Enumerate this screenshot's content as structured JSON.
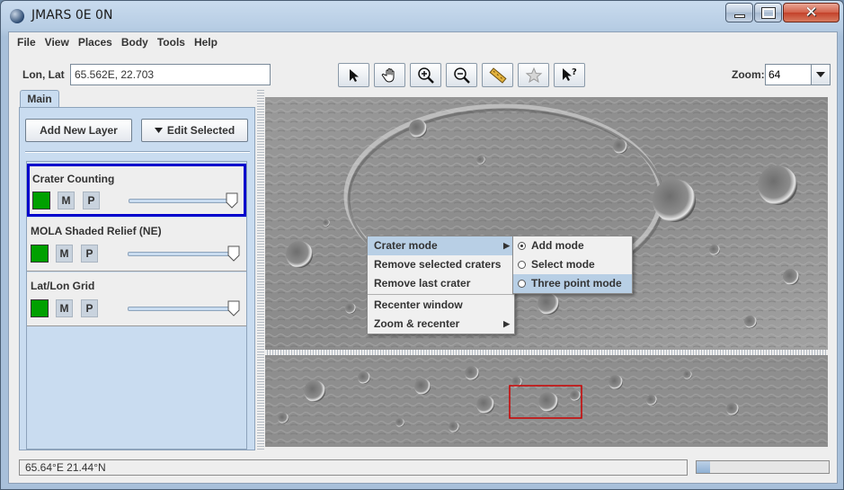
{
  "window": {
    "title": "JMARS 0E 0N"
  },
  "menubar": {
    "items": [
      "File",
      "View",
      "Places",
      "Body",
      "Tools",
      "Help"
    ]
  },
  "toolbar": {
    "lonlat_label": "Lon, Lat",
    "lonlat_value": "65.562E, 22.703",
    "tools": [
      "select-arrow-icon",
      "pan-hand-icon",
      "zoom-in-icon",
      "zoom-out-icon",
      "ruler-icon",
      "investigate-star-icon",
      "pointer-help-icon"
    ],
    "zoom_label": "Zoom:",
    "zoom_value": "64"
  },
  "leftpanel": {
    "tab": "Main",
    "add_layer_button": "Add New Layer",
    "edit_selected_button": "Edit Selected",
    "layers": [
      {
        "name": "Crater Counting",
        "m": "M",
        "p": "P",
        "color": "#00a000"
      },
      {
        "name": "MOLA Shaded Relief (NE)",
        "m": "M",
        "p": "P",
        "color": "#00a000"
      },
      {
        "name": "Lat/Lon Grid",
        "m": "M",
        "p": "P",
        "color": "#00a000"
      }
    ]
  },
  "context_menu": {
    "items": [
      "Crater mode",
      "Remove selected craters",
      "Remove last crater",
      "Recenter window",
      "Zoom & recenter"
    ],
    "submenu": [
      "Add mode",
      "Select mode",
      "Three point mode"
    ]
  },
  "statusbar": {
    "coords": "65.64°E   21.44°N"
  },
  "progress": {
    "fraction": 0.1
  },
  "colors": {
    "selection_border": "#0000cc",
    "menu_highlight": "#b8cfe5",
    "overview_box": "#cc0000"
  }
}
